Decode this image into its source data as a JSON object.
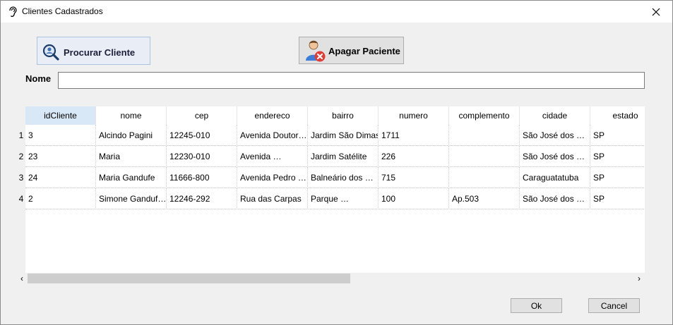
{
  "window": {
    "title": "Clientes Cadastrados"
  },
  "buttons": {
    "search_label": "Procurar Cliente",
    "delete_label": "Apagar Paciente",
    "ok_label": "Ok",
    "cancel_label": "Cancel"
  },
  "search": {
    "label": "Nome",
    "value": ""
  },
  "table": {
    "columns": [
      "idCliente",
      "nome",
      "cep",
      "endereco",
      "bairro",
      "numero",
      "complemento",
      "cidade",
      "estado"
    ],
    "row_numbers": [
      "1",
      "2",
      "3",
      "4"
    ],
    "rows": [
      [
        "3",
        "Alcindo Pagini",
        "12245-010",
        "Avenida Doutor…",
        "Jardim São Dimas",
        "1711",
        "",
        "São José dos …",
        "SP"
      ],
      [
        "23",
        "Maria",
        "12230-010",
        "Avenida …",
        "Jardim Satélite",
        "226",
        "",
        "São José dos …",
        "SP"
      ],
      [
        "24",
        "Maria Gandufe",
        "11666-800",
        "Avenida Pedro …",
        "Balneário dos …",
        "715",
        "",
        "Caraguatatuba",
        "SP"
      ],
      [
        "2",
        "Simone Ganduf…",
        "12246-292",
        "Rua das Carpas",
        "Parque …",
        "100",
        "Ap.503",
        "São José dos …",
        "SP"
      ]
    ]
  },
  "scrollbar": {
    "left_arrow": "‹",
    "right_arrow": "›"
  },
  "icons": {
    "title": "hearing-icon",
    "close": "close-icon",
    "search": "magnifier-user-icon",
    "delete": "user-delete-icon"
  },
  "colors": {
    "header_selected": "#d9e8f7",
    "search_button_bg": "#e9eef6",
    "delete_x": "#e53935"
  }
}
